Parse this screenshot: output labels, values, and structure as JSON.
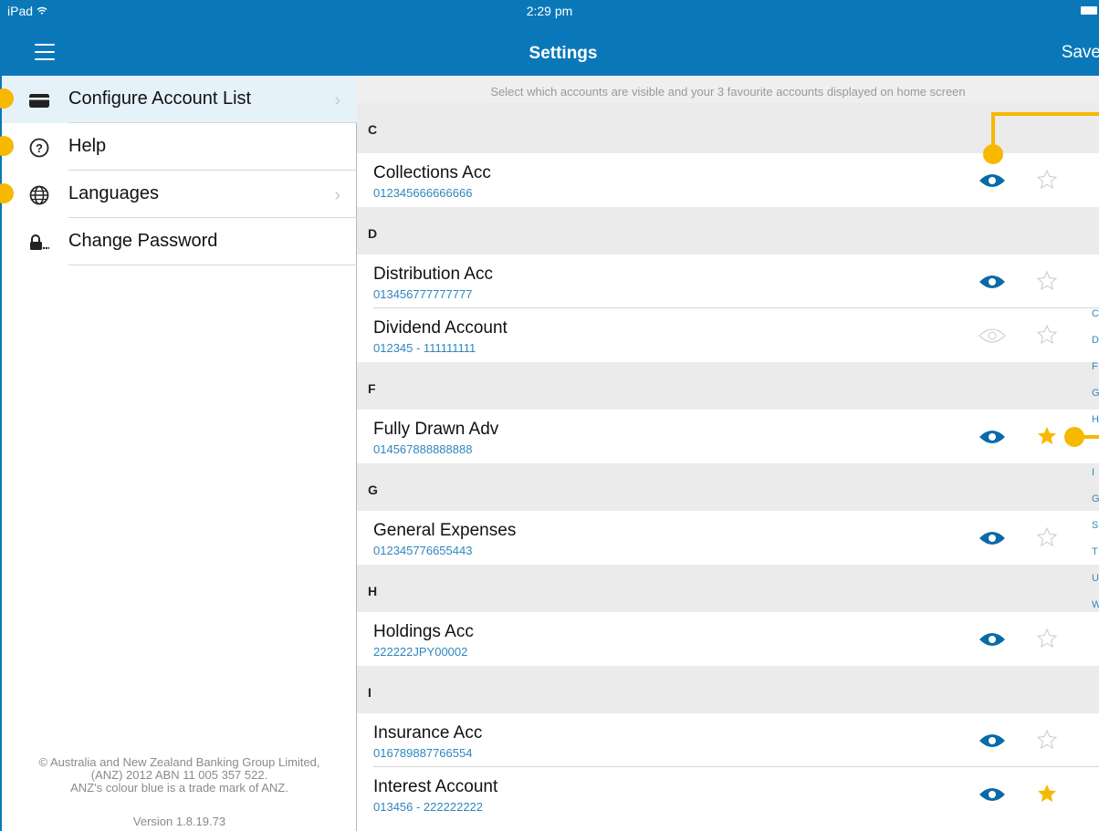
{
  "status": {
    "device": "iPad",
    "time": "2:29 pm"
  },
  "nav": {
    "title": "Settings",
    "save_label": "Save"
  },
  "menu": [
    {
      "label": "Configure Account List",
      "icon": "card-icon",
      "active": true,
      "chevron": true
    },
    {
      "label": "Help",
      "icon": "help-circle-icon",
      "active": false,
      "chevron": false
    },
    {
      "label": "Languages",
      "icon": "globe-icon",
      "active": false,
      "chevron": true
    },
    {
      "label": "Change Password",
      "icon": "lock-password-icon",
      "active": false,
      "chevron": false
    }
  ],
  "footer": {
    "line1": "© Australia and New Zealand Banking Group Limited,",
    "line2": "(ANZ) 2012 ABN 11 005 357 522.",
    "line3": "ANZ's colour blue is a trade mark of ANZ.",
    "version": "Version 1.8.19.73"
  },
  "instruction": "Select which accounts are visible and your 3 favourite accounts displayed on home screen",
  "sections": [
    {
      "letter": "C",
      "accounts": [
        {
          "name": "Collections Acc",
          "number": "012345666666666",
          "visible": true,
          "favourite": false
        }
      ]
    },
    {
      "letter": "D",
      "accounts": [
        {
          "name": "Distribution Acc",
          "number": "013456777777777",
          "visible": true,
          "favourite": false
        },
        {
          "name": "Dividend Account",
          "number": "012345 - 111111111",
          "visible": false,
          "favourite": false
        }
      ]
    },
    {
      "letter": "F",
      "accounts": [
        {
          "name": "Fully Drawn Adv",
          "number": "014567888888888",
          "visible": true,
          "favourite": true
        }
      ]
    },
    {
      "letter": "G",
      "accounts": [
        {
          "name": "General Expenses",
          "number": "012345776655443",
          "visible": true,
          "favourite": false
        }
      ]
    },
    {
      "letter": "H",
      "accounts": [
        {
          "name": "Holdings Acc",
          "number": "222222JPY00002",
          "visible": true,
          "favourite": false
        }
      ]
    },
    {
      "letter": "I",
      "accounts": [
        {
          "name": "Insurance Acc",
          "number": "016789887766554",
          "visible": true,
          "favourite": false
        },
        {
          "name": "Interest Account",
          "number": "013456 - 222222222",
          "visible": true,
          "favourite": true
        }
      ]
    }
  ],
  "index_letters": [
    "C",
    "D",
    "F",
    "G",
    "H",
    "",
    "I",
    "G",
    "S",
    "T",
    "U",
    "W"
  ],
  "colors": {
    "brand": "#0a78b8",
    "callout": "#f7b800",
    "accent_text": "#2e86bf",
    "favourite": "#f7b800"
  }
}
